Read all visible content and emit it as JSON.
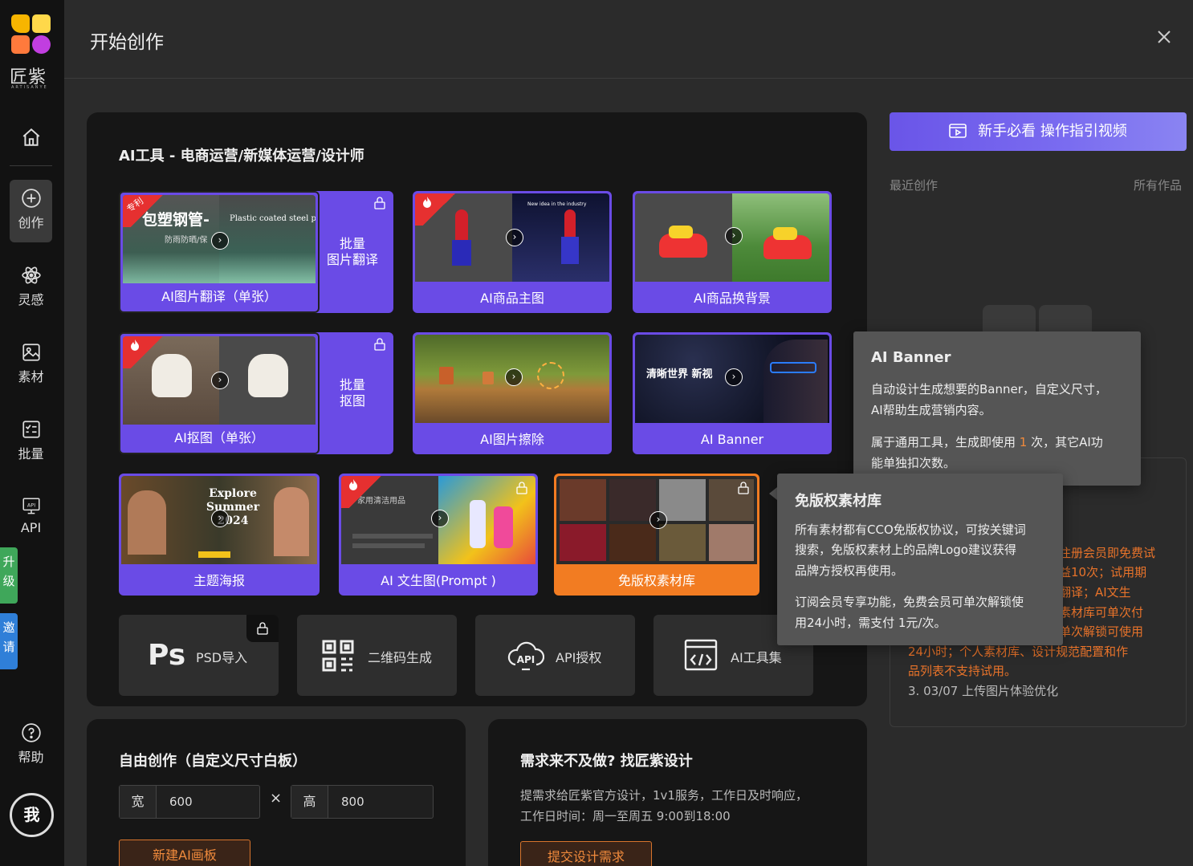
{
  "logo": {
    "text": "匠紫",
    "sub": "ARTISANYE"
  },
  "nav": {
    "create": "创作",
    "inspire": "灵感",
    "assets": "素材",
    "batch": "批量",
    "api": "API",
    "help": "帮助",
    "upgrade": "升级",
    "invite": "邀请",
    "me": "我"
  },
  "header": {
    "title": "开始创作"
  },
  "ai_tools": {
    "title": "AI工具 - 电商运营/新媒体运营/设计师",
    "cards": [
      {
        "label": "AI图片翻译（单张）",
        "badge": "专利",
        "thumb_text": "包塑钢管-",
        "thumb_sub": "防雨防晒/保",
        "thumb_en": "Plastic coated steel pip"
      },
      {
        "label": "AI商品主图",
        "thumb_en": "New idea in the industry"
      },
      {
        "label": "AI商品换背景"
      },
      {
        "label": "AI抠图（单张）"
      },
      {
        "label": "AI图片擦除"
      },
      {
        "label": "AI Banner",
        "thumb_text": "清晰世界 新视"
      },
      {
        "label": "主题海报",
        "thumb_text": "Explore Summer 2024"
      },
      {
        "label": "AI 文生图(Prompt )",
        "thumb_text": "家用清洁用品"
      },
      {
        "label": "免版权素材库"
      }
    ],
    "batch_translate": "批量\n图片翻译",
    "batch_cutout": "批量\n抠图",
    "tools": [
      {
        "label": "PSD导入",
        "icon": "ps-icon"
      },
      {
        "label": "二维码生成",
        "icon": "qrcode-icon"
      },
      {
        "label": "API授权",
        "icon": "api-cloud-icon"
      },
      {
        "label": "AI工具集",
        "icon": "code-window-icon"
      }
    ]
  },
  "free_create": {
    "title": "自由创作（自定义尺寸白板）",
    "width_label": "宽",
    "width_value": "600",
    "times": "×",
    "height_label": "高",
    "height_value": "800",
    "button": "新建AI画板"
  },
  "design_request": {
    "title": "需求来不及做? 找匠紫设计",
    "desc1": "提需求给匠紫官方设计，1v1服务，工作日及时响应，",
    "desc2": "工作日时间：周一至周五 9:00到18:00",
    "button": "提交设计需求"
  },
  "right": {
    "guide": "新手必看 操作指引视频",
    "recent": "最近创作",
    "all": "所有作品",
    "notice_lines": [
      "注册会员即免费试",
      "益10次；试用期",
      "翻译；AI文生",
      "素材库可单次付",
      "单次解锁可使用",
      "24小时；个人素材库、设计规范配置和作",
      "品列表不支持试用。",
      "3. 03/07 上传图片体验优化"
    ]
  },
  "tooltip_banner": {
    "title": "AI Banner",
    "line1": "自动设计生成想要的Banner，自定义尺寸，",
    "line2": "AI帮助生成营销内容。",
    "line3a": "属于通用工具，生成即使用",
    "line3num": "1",
    "line3b": "次，其它AI功",
    "line4": "能单独扣次数。"
  },
  "tooltip_library": {
    "title": "免版权素材库",
    "line1": "所有素材都有CCO免版权协议，可按关键词",
    "line2": "搜索，免版权素材上的品牌Logo建议获得",
    "line3": "品牌方授权再使用。",
    "line4": "订阅会员专享功能，免费会员可单次解锁使",
    "line5": "用24小时，需支付 1元/次。"
  },
  "colors": {
    "accent": "#6a4be6",
    "orange": "#f27c22",
    "notice_orange": "#e8732a",
    "hot_red": "#e63030"
  }
}
